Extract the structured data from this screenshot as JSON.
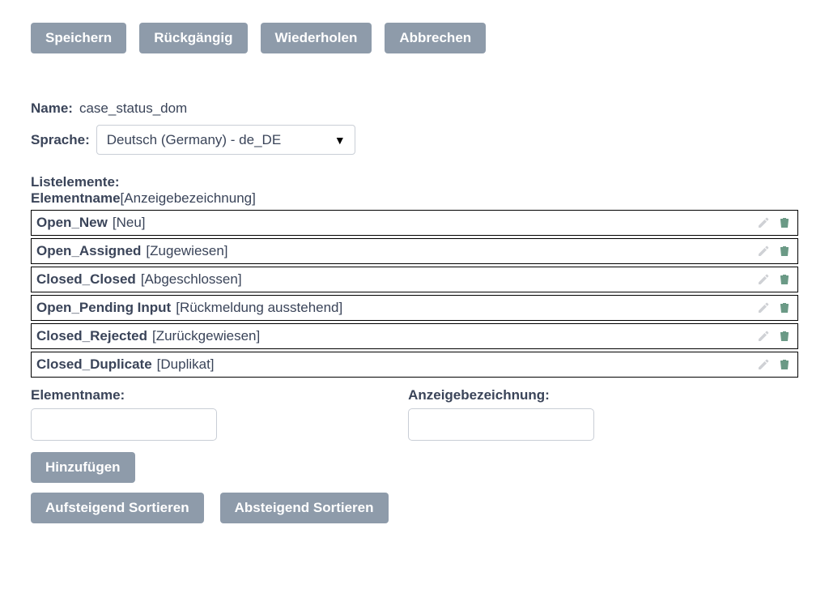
{
  "toolbar": {
    "save_label": "Speichern",
    "undo_label": "Rückgängig",
    "redo_label": "Wiederholen",
    "cancel_label": "Abbrechen"
  },
  "fields": {
    "name_label": "Name:",
    "name_value": "case_status_dom",
    "language_label": "Sprache:",
    "language_value": "Deutsch (Germany) - de_DE"
  },
  "list_header": {
    "list_label": "Listelemente:",
    "elementname_label": "Elementname",
    "anzeige_suffix": "[Anzeigebezeichnung]"
  },
  "items": [
    {
      "name": "Open_New",
      "display": "[Neu]"
    },
    {
      "name": "Open_Assigned",
      "display": "[Zugewiesen]"
    },
    {
      "name": "Closed_Closed",
      "display": "[Abgeschlossen]"
    },
    {
      "name": "Open_Pending Input",
      "display": "[Rückmeldung ausstehend]"
    },
    {
      "name": "Closed_Rejected",
      "display": "[Zurückgewiesen]"
    },
    {
      "name": "Closed_Duplicate",
      "display": "[Duplikat]"
    }
  ],
  "add_form": {
    "elementname_label": "Elementname:",
    "anzeige_label": "Anzeigebezeichnung:",
    "elementname_value": "",
    "anzeige_value": "",
    "add_label": "Hinzufügen"
  },
  "sort": {
    "asc_label": "Aufsteigend Sortieren",
    "desc_label": "Absteigend Sortieren"
  },
  "icons": {
    "edit_color": "#cfd1d5",
    "delete_color": "#6b9a86"
  }
}
